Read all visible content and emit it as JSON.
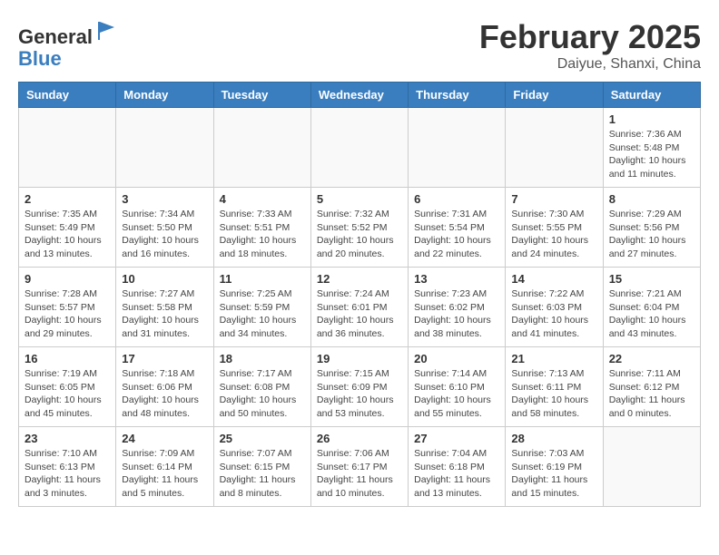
{
  "logo": {
    "general": "General",
    "blue": "Blue"
  },
  "header": {
    "month": "February 2025",
    "location": "Daiyue, Shanxi, China"
  },
  "weekdays": [
    "Sunday",
    "Monday",
    "Tuesday",
    "Wednesday",
    "Thursday",
    "Friday",
    "Saturday"
  ],
  "weeks": [
    [
      {
        "day": "",
        "info": ""
      },
      {
        "day": "",
        "info": ""
      },
      {
        "day": "",
        "info": ""
      },
      {
        "day": "",
        "info": ""
      },
      {
        "day": "",
        "info": ""
      },
      {
        "day": "",
        "info": ""
      },
      {
        "day": "1",
        "info": "Sunrise: 7:36 AM\nSunset: 5:48 PM\nDaylight: 10 hours\nand 11 minutes."
      }
    ],
    [
      {
        "day": "2",
        "info": "Sunrise: 7:35 AM\nSunset: 5:49 PM\nDaylight: 10 hours\nand 13 minutes."
      },
      {
        "day": "3",
        "info": "Sunrise: 7:34 AM\nSunset: 5:50 PM\nDaylight: 10 hours\nand 16 minutes."
      },
      {
        "day": "4",
        "info": "Sunrise: 7:33 AM\nSunset: 5:51 PM\nDaylight: 10 hours\nand 18 minutes."
      },
      {
        "day": "5",
        "info": "Sunrise: 7:32 AM\nSunset: 5:52 PM\nDaylight: 10 hours\nand 20 minutes."
      },
      {
        "day": "6",
        "info": "Sunrise: 7:31 AM\nSunset: 5:54 PM\nDaylight: 10 hours\nand 22 minutes."
      },
      {
        "day": "7",
        "info": "Sunrise: 7:30 AM\nSunset: 5:55 PM\nDaylight: 10 hours\nand 24 minutes."
      },
      {
        "day": "8",
        "info": "Sunrise: 7:29 AM\nSunset: 5:56 PM\nDaylight: 10 hours\nand 27 minutes."
      }
    ],
    [
      {
        "day": "9",
        "info": "Sunrise: 7:28 AM\nSunset: 5:57 PM\nDaylight: 10 hours\nand 29 minutes."
      },
      {
        "day": "10",
        "info": "Sunrise: 7:27 AM\nSunset: 5:58 PM\nDaylight: 10 hours\nand 31 minutes."
      },
      {
        "day": "11",
        "info": "Sunrise: 7:25 AM\nSunset: 5:59 PM\nDaylight: 10 hours\nand 34 minutes."
      },
      {
        "day": "12",
        "info": "Sunrise: 7:24 AM\nSunset: 6:01 PM\nDaylight: 10 hours\nand 36 minutes."
      },
      {
        "day": "13",
        "info": "Sunrise: 7:23 AM\nSunset: 6:02 PM\nDaylight: 10 hours\nand 38 minutes."
      },
      {
        "day": "14",
        "info": "Sunrise: 7:22 AM\nSunset: 6:03 PM\nDaylight: 10 hours\nand 41 minutes."
      },
      {
        "day": "15",
        "info": "Sunrise: 7:21 AM\nSunset: 6:04 PM\nDaylight: 10 hours\nand 43 minutes."
      }
    ],
    [
      {
        "day": "16",
        "info": "Sunrise: 7:19 AM\nSunset: 6:05 PM\nDaylight: 10 hours\nand 45 minutes."
      },
      {
        "day": "17",
        "info": "Sunrise: 7:18 AM\nSunset: 6:06 PM\nDaylight: 10 hours\nand 48 minutes."
      },
      {
        "day": "18",
        "info": "Sunrise: 7:17 AM\nSunset: 6:08 PM\nDaylight: 10 hours\nand 50 minutes."
      },
      {
        "day": "19",
        "info": "Sunrise: 7:15 AM\nSunset: 6:09 PM\nDaylight: 10 hours\nand 53 minutes."
      },
      {
        "day": "20",
        "info": "Sunrise: 7:14 AM\nSunset: 6:10 PM\nDaylight: 10 hours\nand 55 minutes."
      },
      {
        "day": "21",
        "info": "Sunrise: 7:13 AM\nSunset: 6:11 PM\nDaylight: 10 hours\nand 58 minutes."
      },
      {
        "day": "22",
        "info": "Sunrise: 7:11 AM\nSunset: 6:12 PM\nDaylight: 11 hours\nand 0 minutes."
      }
    ],
    [
      {
        "day": "23",
        "info": "Sunrise: 7:10 AM\nSunset: 6:13 PM\nDaylight: 11 hours\nand 3 minutes."
      },
      {
        "day": "24",
        "info": "Sunrise: 7:09 AM\nSunset: 6:14 PM\nDaylight: 11 hours\nand 5 minutes."
      },
      {
        "day": "25",
        "info": "Sunrise: 7:07 AM\nSunset: 6:15 PM\nDaylight: 11 hours\nand 8 minutes."
      },
      {
        "day": "26",
        "info": "Sunrise: 7:06 AM\nSunset: 6:17 PM\nDaylight: 11 hours\nand 10 minutes."
      },
      {
        "day": "27",
        "info": "Sunrise: 7:04 AM\nSunset: 6:18 PM\nDaylight: 11 hours\nand 13 minutes."
      },
      {
        "day": "28",
        "info": "Sunrise: 7:03 AM\nSunset: 6:19 PM\nDaylight: 11 hours\nand 15 minutes."
      },
      {
        "day": "",
        "info": ""
      }
    ]
  ]
}
